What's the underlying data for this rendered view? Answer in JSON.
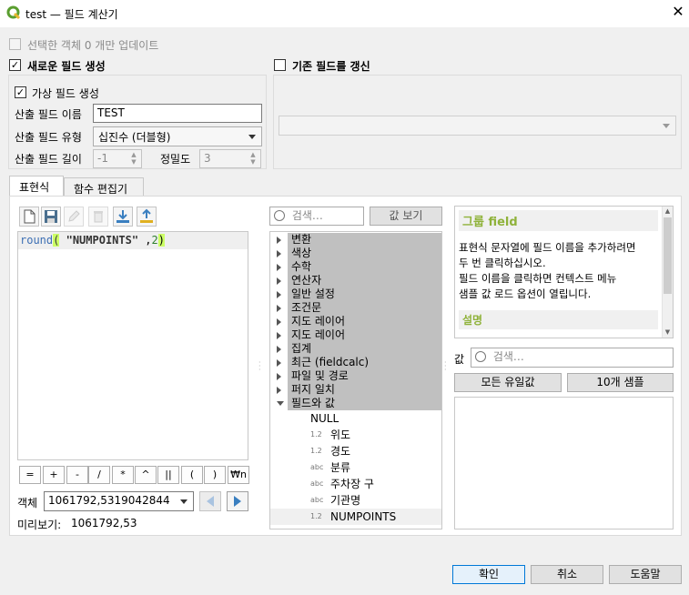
{
  "window": {
    "title": "test — 필드 계산기",
    "close_glyph": "✕"
  },
  "update_selected": {
    "label": "선택한 객체 0 개만 업데이트",
    "checked": false
  },
  "new_field": {
    "label": "새로운 필드 생성",
    "checked": true,
    "virtual_label": "가상 필드 생성",
    "virtual_checked": true,
    "name_label": "산출 필드 이름",
    "name_value": "TEST",
    "type_label": "산출 필드 유형",
    "type_value": "십진수 (더블형)",
    "length_label": "산출 필드 길이",
    "length_value": "-1",
    "precision_label": "정밀도",
    "precision_value": "3"
  },
  "update_existing": {
    "label": "기존 필드를 갱신",
    "checked": false
  },
  "tabs": [
    {
      "label": "표현식",
      "active": true
    },
    {
      "label": "함수 편집기",
      "active": false
    }
  ],
  "expression": {
    "func": "round",
    "open": "(",
    "arg1": "\"NUMPOINTS\"",
    "sep": " ,",
    "arg2": "2",
    "close": ")"
  },
  "operators": [
    "=",
    "+",
    "-",
    "/",
    "*",
    "^",
    "||",
    "(",
    ")",
    "₩n"
  ],
  "feature": {
    "label": "객체",
    "value": "1061792,5319042844"
  },
  "preview": {
    "label": "미리보기:",
    "value": "1061792,53"
  },
  "search": {
    "placeholder": "검색…",
    "show_values": "값 보기"
  },
  "groups": [
    "변환",
    "색상",
    "수학",
    "연산자",
    "일반 설정",
    "조건문",
    "지도 레이어",
    "지도 레이어",
    "집계",
    "최근 (fieldcalc)",
    "파일 및 경로",
    "퍼지 일치",
    "필드와 값"
  ],
  "fields": [
    {
      "type": "",
      "name": "NULL"
    },
    {
      "type": "1.2",
      "name": "위도"
    },
    {
      "type": "1.2",
      "name": "경도"
    },
    {
      "type": "abc",
      "name": "분류"
    },
    {
      "type": "abc",
      "name": "주차장 구"
    },
    {
      "type": "abc",
      "name": "기관명"
    },
    {
      "type": "1.2",
      "name": "NUMPOINTS"
    }
  ],
  "help": {
    "group_title": "그룹 field",
    "line1": "표현식 문자열에 필드 이름을 추가하려면",
    "line2": "두 번 클릭하십시오.",
    "line3": "필드 이름을 클릭하면 컨텍스트 메뉴",
    "line4": "샘플 값 로드 옵션이 열립니다.",
    "desc_title": "설명"
  },
  "values": {
    "label": "값",
    "placeholder": "검색…",
    "all_unique": "모든 유일값",
    "ten_samples": "10개 샘플"
  },
  "buttons": {
    "ok": "확인",
    "cancel": "취소",
    "help": "도움말"
  },
  "colors": {
    "accent": "#8fb23a",
    "group_bg": "#c0c0c0",
    "highlight": "#ccff66"
  }
}
